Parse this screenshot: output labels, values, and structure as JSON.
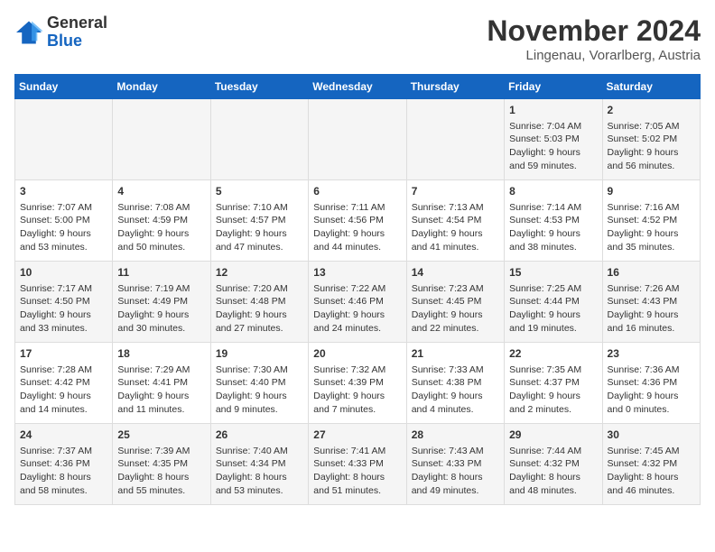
{
  "logo": {
    "general": "General",
    "blue": "Blue"
  },
  "title": "November 2024",
  "location": "Lingenau, Vorarlberg, Austria",
  "weekdays": [
    "Sunday",
    "Monday",
    "Tuesday",
    "Wednesday",
    "Thursday",
    "Friday",
    "Saturday"
  ],
  "weeks": [
    [
      {
        "day": "",
        "info": ""
      },
      {
        "day": "",
        "info": ""
      },
      {
        "day": "",
        "info": ""
      },
      {
        "day": "",
        "info": ""
      },
      {
        "day": "",
        "info": ""
      },
      {
        "day": "1",
        "info": "Sunrise: 7:04 AM\nSunset: 5:03 PM\nDaylight: 9 hours and 59 minutes."
      },
      {
        "day": "2",
        "info": "Sunrise: 7:05 AM\nSunset: 5:02 PM\nDaylight: 9 hours and 56 minutes."
      }
    ],
    [
      {
        "day": "3",
        "info": "Sunrise: 7:07 AM\nSunset: 5:00 PM\nDaylight: 9 hours and 53 minutes."
      },
      {
        "day": "4",
        "info": "Sunrise: 7:08 AM\nSunset: 4:59 PM\nDaylight: 9 hours and 50 minutes."
      },
      {
        "day": "5",
        "info": "Sunrise: 7:10 AM\nSunset: 4:57 PM\nDaylight: 9 hours and 47 minutes."
      },
      {
        "day": "6",
        "info": "Sunrise: 7:11 AM\nSunset: 4:56 PM\nDaylight: 9 hours and 44 minutes."
      },
      {
        "day": "7",
        "info": "Sunrise: 7:13 AM\nSunset: 4:54 PM\nDaylight: 9 hours and 41 minutes."
      },
      {
        "day": "8",
        "info": "Sunrise: 7:14 AM\nSunset: 4:53 PM\nDaylight: 9 hours and 38 minutes."
      },
      {
        "day": "9",
        "info": "Sunrise: 7:16 AM\nSunset: 4:52 PM\nDaylight: 9 hours and 35 minutes."
      }
    ],
    [
      {
        "day": "10",
        "info": "Sunrise: 7:17 AM\nSunset: 4:50 PM\nDaylight: 9 hours and 33 minutes."
      },
      {
        "day": "11",
        "info": "Sunrise: 7:19 AM\nSunset: 4:49 PM\nDaylight: 9 hours and 30 minutes."
      },
      {
        "day": "12",
        "info": "Sunrise: 7:20 AM\nSunset: 4:48 PM\nDaylight: 9 hours and 27 minutes."
      },
      {
        "day": "13",
        "info": "Sunrise: 7:22 AM\nSunset: 4:46 PM\nDaylight: 9 hours and 24 minutes."
      },
      {
        "day": "14",
        "info": "Sunrise: 7:23 AM\nSunset: 4:45 PM\nDaylight: 9 hours and 22 minutes."
      },
      {
        "day": "15",
        "info": "Sunrise: 7:25 AM\nSunset: 4:44 PM\nDaylight: 9 hours and 19 minutes."
      },
      {
        "day": "16",
        "info": "Sunrise: 7:26 AM\nSunset: 4:43 PM\nDaylight: 9 hours and 16 minutes."
      }
    ],
    [
      {
        "day": "17",
        "info": "Sunrise: 7:28 AM\nSunset: 4:42 PM\nDaylight: 9 hours and 14 minutes."
      },
      {
        "day": "18",
        "info": "Sunrise: 7:29 AM\nSunset: 4:41 PM\nDaylight: 9 hours and 11 minutes."
      },
      {
        "day": "19",
        "info": "Sunrise: 7:30 AM\nSunset: 4:40 PM\nDaylight: 9 hours and 9 minutes."
      },
      {
        "day": "20",
        "info": "Sunrise: 7:32 AM\nSunset: 4:39 PM\nDaylight: 9 hours and 7 minutes."
      },
      {
        "day": "21",
        "info": "Sunrise: 7:33 AM\nSunset: 4:38 PM\nDaylight: 9 hours and 4 minutes."
      },
      {
        "day": "22",
        "info": "Sunrise: 7:35 AM\nSunset: 4:37 PM\nDaylight: 9 hours and 2 minutes."
      },
      {
        "day": "23",
        "info": "Sunrise: 7:36 AM\nSunset: 4:36 PM\nDaylight: 9 hours and 0 minutes."
      }
    ],
    [
      {
        "day": "24",
        "info": "Sunrise: 7:37 AM\nSunset: 4:36 PM\nDaylight: 8 hours and 58 minutes."
      },
      {
        "day": "25",
        "info": "Sunrise: 7:39 AM\nSunset: 4:35 PM\nDaylight: 8 hours and 55 minutes."
      },
      {
        "day": "26",
        "info": "Sunrise: 7:40 AM\nSunset: 4:34 PM\nDaylight: 8 hours and 53 minutes."
      },
      {
        "day": "27",
        "info": "Sunrise: 7:41 AM\nSunset: 4:33 PM\nDaylight: 8 hours and 51 minutes."
      },
      {
        "day": "28",
        "info": "Sunrise: 7:43 AM\nSunset: 4:33 PM\nDaylight: 8 hours and 49 minutes."
      },
      {
        "day": "29",
        "info": "Sunrise: 7:44 AM\nSunset: 4:32 PM\nDaylight: 8 hours and 48 minutes."
      },
      {
        "day": "30",
        "info": "Sunrise: 7:45 AM\nSunset: 4:32 PM\nDaylight: 8 hours and 46 minutes."
      }
    ]
  ]
}
